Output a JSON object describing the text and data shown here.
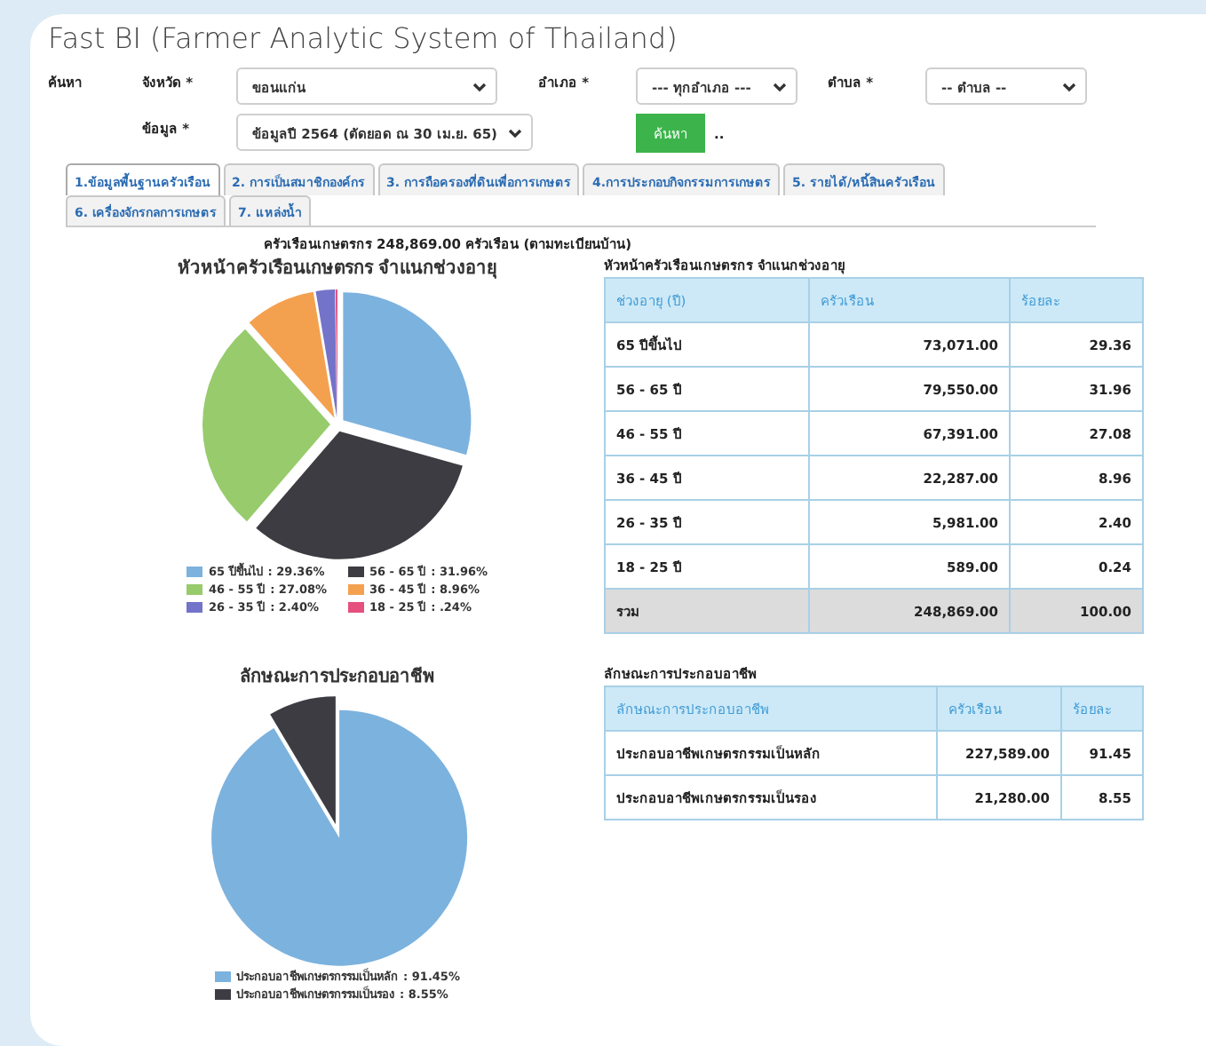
{
  "app": {
    "title": "Fast BI (Farmer Analytic System of Thailand)"
  },
  "search": {
    "label": "ค้นหา",
    "fields": [
      {
        "label": "จังหวัด *",
        "value": "ขอนแก่น"
      },
      {
        "label": "อำเภอ *",
        "value": "--- ทุกอำเภอ ---"
      },
      {
        "label": "ตำบล *",
        "value": "-- ตำบล --"
      },
      {
        "label": "ข้อมูล *",
        "value": "ข้อมูลปี 2564 (ตัดยอด ณ 30 เม.ย. 65)"
      }
    ],
    "button": "ค้นหา",
    "note": ".."
  },
  "tabs": [
    {
      "label": "1.ข้อมูลพื้นฐานครัวเรือน",
      "selected": true
    },
    {
      "label": "2. การเป็นสมาชิกองค์กร",
      "selected": false
    },
    {
      "label": "3. การถือครองที่ดินเพื่อการเกษตร",
      "selected": false
    },
    {
      "label": "4.การประกอบกิจกรรมการเกษตร",
      "selected": false
    },
    {
      "label": "5. รายได้/หนี้สินครัวเรือน",
      "selected": false
    },
    {
      "label": "6. เครื่องจักรกลการเกษตร",
      "selected": false
    },
    {
      "label": "7. แหล่งน้ำ",
      "selected": false
    }
  ],
  "summary": "ครัวเรือนเกษตรกร 248,869.00 ครัวเรือน (ตามทะเบียนบ้าน)",
  "sections": [
    {
      "chart": {
        "chart_data": {
          "type": "pie",
          "title": "หัวหน้าครัวเรือนเกษตรกร จำแนกช่วงอายุ",
          "categories": [
            "65 ปีขึ้นไป",
            "56 - 65 ปี",
            "46 - 55 ปี",
            "36 - 45 ปี",
            "26 - 35 ปี",
            "18 - 25 ปี"
          ],
          "values": [
            29.36,
            31.96,
            27.08,
            8.96,
            2.4,
            0.24
          ]
        },
        "legend": [
          {
            "value_label": ": 29.36%",
            "color": "#7cb2de"
          },
          {
            "value_label": ": 31.96%",
            "color": "#3c3c42"
          },
          {
            "value_label": ": 27.08%",
            "color": "#97cb6c"
          },
          {
            "value_label": ": 8.96%",
            "color": "#f4a14f"
          },
          {
            "value_label": ": 2.40%",
            "color": "#7373c9"
          },
          {
            "value_label": ": .24%",
            "color": "#e5507e"
          }
        ]
      },
      "table": {
        "title": "หัวหน้าครัวเรือนเกษตรกร จำแนกช่วงอายุ",
        "columns": [
          "ช่วงอายุ (ปี)",
          "ครัวเรือน",
          "ร้อยละ"
        ],
        "rows": [
          {
            "kind": "data",
            "cells": [
              "65 ปีขึ้นไป",
              "73,071.00",
              "29.36"
            ]
          },
          {
            "kind": "data",
            "cells": [
              "56 - 65 ปี",
              "79,550.00",
              "31.96"
            ]
          },
          {
            "kind": "data",
            "cells": [
              "46 - 55 ปี",
              "67,391.00",
              "27.08"
            ]
          },
          {
            "kind": "data",
            "cells": [
              "36 - 45 ปี",
              "22,287.00",
              "8.96"
            ]
          },
          {
            "kind": "data",
            "cells": [
              "26 - 35 ปี",
              "5,981.00",
              "2.40"
            ]
          },
          {
            "kind": "data",
            "cells": [
              "18 - 25 ปี",
              "589.00",
              "0.24"
            ]
          },
          {
            "kind": "total",
            "cells": [
              "รวม",
              "248,869.00",
              "100.00"
            ]
          }
        ]
      }
    },
    {
      "chart": {
        "chart_data": {
          "type": "pie",
          "title": "ลักษณะการประกอบอาชีพ",
          "categories": [
            "ประกอบอาชีพเกษตรกรรมเป็นหลัก",
            "ประกอบอาชีพเกษตรกรรมเป็นรอง"
          ],
          "values": [
            91.45,
            8.55
          ]
        },
        "legend": [
          {
            "value_label": ": 91.45%",
            "color": "#7cb2de"
          },
          {
            "value_label": ": 8.55%",
            "color": "#3c3c42"
          }
        ]
      },
      "table": {
        "title": "ลักษณะการประกอบอาชีพ",
        "columns": [
          "ลักษณะการประกอบอาชีพ",
          "ครัวเรือน",
          "ร้อยละ"
        ],
        "rows": [
          {
            "kind": "data",
            "cells": [
              "ประกอบอาชีพเกษตรกรรมเป็นหลัก",
              "227,589.00",
              "91.45"
            ]
          },
          {
            "kind": "data",
            "cells": [
              "ประกอบอาชีพเกษตรกรรมเป็นรอง",
              "21,280.00",
              "8.55"
            ]
          }
        ]
      }
    }
  ]
}
